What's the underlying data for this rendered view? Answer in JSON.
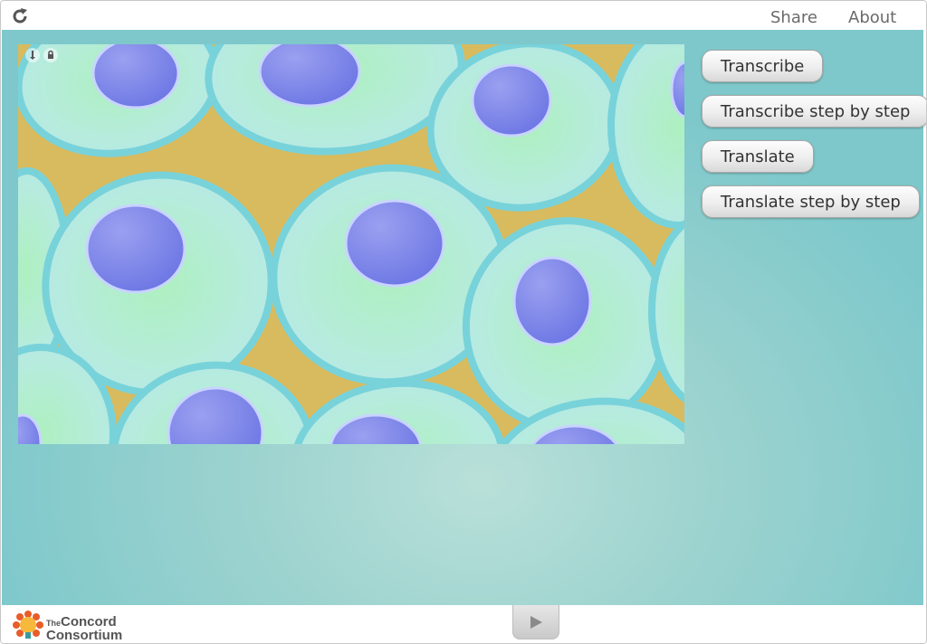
{
  "topbar": {
    "reload_icon": "reload-icon",
    "share_label": "Share",
    "about_label": "About"
  },
  "scene": {
    "controls": [
      "info-icon",
      "lock-icon"
    ],
    "colors": {
      "cytoplasm": "#b8ecc6",
      "membrane": "#79d3da",
      "nucleus": "#7781e8",
      "extracellular": "#d6b95c"
    }
  },
  "actions": {
    "transcribe": "Transcribe",
    "transcribe_step": "Transcribe step by step",
    "translate": "Translate",
    "translate_step": "Translate step by step"
  },
  "footer": {
    "logo_line1_small": "The",
    "logo_line1": "Concord",
    "logo_line2": "Consortium",
    "play_icon": "play-icon"
  }
}
